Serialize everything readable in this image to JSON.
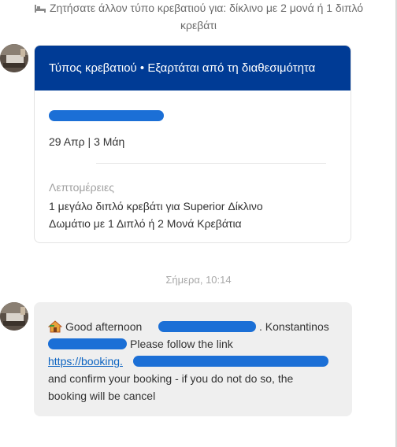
{
  "system_message": {
    "icon": "bed-icon",
    "text_line1": "Ζητήσατε άλλον τύπο κρεβατιού για: δίκλινο με 2 μονά ή 1 διπλό",
    "text_line2": "κρεβάτι"
  },
  "card": {
    "header": "Τύπος κρεβατιού • Εξαρτάται από τη διαθεσιμότητα",
    "dates": "29 Απρ | 3 Μάη",
    "details_label": "Λεπτομέρειες",
    "details_line1": "1 μεγάλο διπλό κρεβάτι για Superior Δίκλινο",
    "details_line2": "Δωμάτιο με 1 Διπλό ή 2 Μονά Κρεβάτια"
  },
  "timestamp": "Σήμερα, 10:14",
  "message": {
    "icon": "house-icon",
    "line1_start": "Good afternoon",
    "line1_end": ". Konstantinos",
    "line2_end": "Please follow the link",
    "link_text": "https://booking.",
    "line4": "and confirm your booking  - if you do not do so, the",
    "line5": "booking will be cancel"
  },
  "colors": {
    "header_bg": "#003b95",
    "redaction": "#1b6fd6",
    "bubble_bg": "#efefef",
    "link": "#0b63c1"
  }
}
